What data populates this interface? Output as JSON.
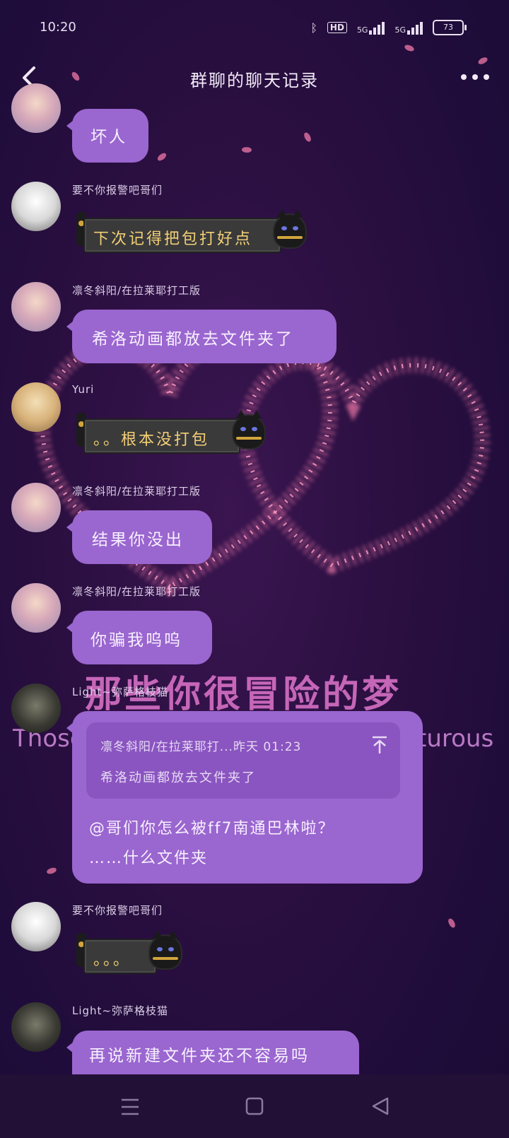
{
  "status_bar": {
    "time": "10:20",
    "hd_label": "HD",
    "signal1_label": "5G",
    "signal2_label": "5G",
    "battery": "73"
  },
  "header": {
    "title": "群聊的聊天记录"
  },
  "background_overlay": {
    "cn_text": "那些你很冒险的梦",
    "en_left": "Those",
    "en_right": "turous"
  },
  "messages": [
    {
      "text": "坏人"
    },
    {
      "sender": "要不你报警吧哥们",
      "text": "下次记得把包打好点"
    },
    {
      "sender": "凛冬斜阳/在拉莱耶打工版",
      "text": "希洛动画都放去文件夹了"
    },
    {
      "sender": "Yuri",
      "text": "。。根本没打包"
    },
    {
      "sender": "凛冬斜阳/在拉莱耶打工版",
      "text": "结果你没出"
    },
    {
      "sender": "凛冬斜阳/在拉莱耶打工版",
      "text": "你骗我呜呜"
    },
    {
      "sender": "Light~弥萨格枝猫",
      "quote_header": "凛冬斜阳/在拉莱耶打...昨天 01:23",
      "quote_body": "希洛动画都放去文件夹了",
      "line1": "@哥们你怎么被ff7南通巴林啦？",
      "line2": "……什么文件夹"
    },
    {
      "sender": "要不你报警吧哥们",
      "text": "。。。"
    },
    {
      "sender": "Light~弥萨格枝猫",
      "text": "再说新建文件夹还不容易吗"
    }
  ],
  "colors": {
    "bubble": "#9a66cf",
    "background": "#2a0f40",
    "heart_petals": "#f07aa8",
    "dark_bubble_text": "#f3cf77"
  }
}
